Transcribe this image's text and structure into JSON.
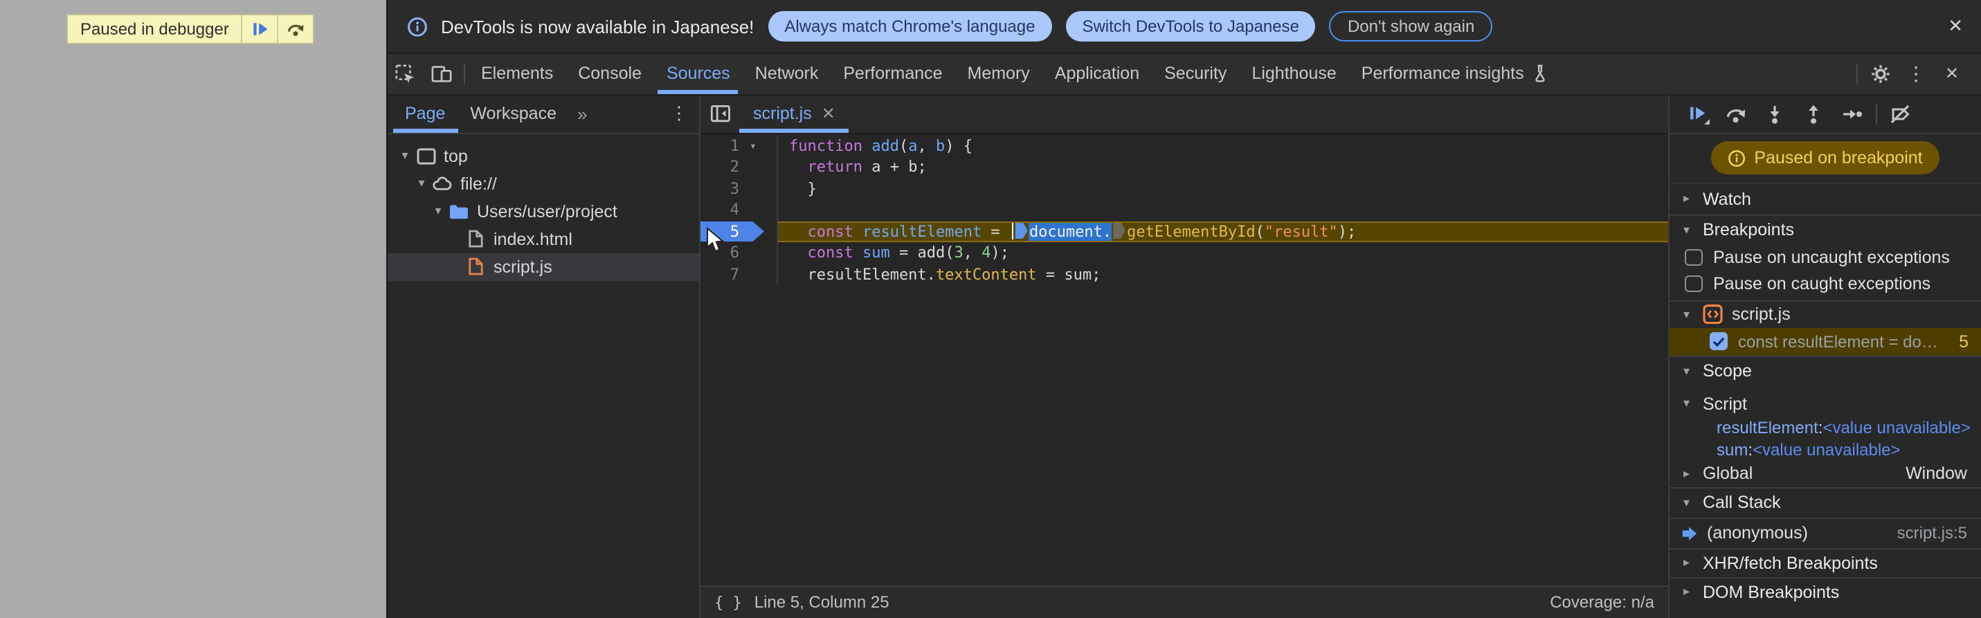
{
  "page": {
    "paused_banner_label": "Paused in debugger"
  },
  "infobar": {
    "message": "DevTools is now available in Japanese!",
    "buttons": [
      "Always match Chrome's language",
      "Switch DevTools to Japanese",
      "Don't show again"
    ],
    "close": "✕"
  },
  "tabbar": {
    "tabs": [
      "Elements",
      "Console",
      "Sources",
      "Network",
      "Performance",
      "Memory",
      "Application",
      "Security",
      "Lighthouse",
      "Performance insights"
    ],
    "active": "Sources",
    "menu": "⋮",
    "close": "✕"
  },
  "navigator": {
    "tabs": {
      "page": "Page",
      "workspace": "Workspace",
      "more": "»",
      "menu": "⋮"
    },
    "tree": {
      "top": "top",
      "file_scheme": "file://",
      "folder": "Users/user/project",
      "file1": "index.html",
      "file2": "script.js"
    }
  },
  "editor": {
    "tab_label": "script.js",
    "tab_close": "✕",
    "code": {
      "lines": [
        {
          "num": 1,
          "fold": true,
          "tokens": [
            {
              "t": "function",
              "c": "kw"
            },
            {
              "t": " "
            },
            {
              "t": "add",
              "c": "def"
            },
            {
              "t": "("
            },
            {
              "t": "a",
              "c": "def"
            },
            {
              "t": ", "
            },
            {
              "t": "b",
              "c": "def"
            },
            {
              "t": ") {"
            }
          ]
        },
        {
          "num": 2,
          "tokens": [
            {
              "t": "  "
            },
            {
              "t": "return",
              "c": "kw"
            },
            {
              "t": " a + b;"
            }
          ]
        },
        {
          "num": 3,
          "tokens": [
            {
              "t": "  }"
            }
          ]
        },
        {
          "num": 4,
          "tokens": []
        },
        {
          "num": 5,
          "current": true,
          "breakpoint": true,
          "tokens": [
            {
              "t": "  "
            },
            {
              "t": "const",
              "c": "kw"
            },
            {
              "t": " "
            },
            {
              "t": "resultElement",
              "c": "def"
            },
            {
              "t": " = "
            },
            {
              "m": "caret"
            },
            {
              "m": "blue"
            },
            {
              "t": "document.",
              "c": "sel"
            },
            {
              "m": "grey"
            },
            {
              "t": "getElementById",
              "c": "prop"
            },
            {
              "t": "("
            },
            {
              "t": "\"result\"",
              "c": "str"
            },
            {
              "t": ");"
            }
          ]
        },
        {
          "num": 6,
          "tokens": [
            {
              "t": "  "
            },
            {
              "t": "const",
              "c": "kw"
            },
            {
              "t": " "
            },
            {
              "t": "sum",
              "c": "def"
            },
            {
              "t": " = add("
            },
            {
              "t": "3",
              "c": "num"
            },
            {
              "t": ", "
            },
            {
              "t": "4",
              "c": "num"
            },
            {
              "t": ");"
            }
          ]
        },
        {
          "num": 7,
          "tokens": [
            {
              "t": "  resultElement."
            },
            {
              "t": "textContent",
              "c": "prop"
            },
            {
              "t": " = sum;"
            }
          ]
        }
      ]
    },
    "status": {
      "line_col": "Line 5, Column 25",
      "braces": "{ }",
      "coverage": "Coverage: n/a"
    }
  },
  "debugger": {
    "paused_badge": "Paused on breakpoint",
    "watch": "Watch",
    "breakpoints": "Breakpoints",
    "pause_uncaught": "Pause on uncaught exceptions",
    "pause_caught": "Pause on caught exceptions",
    "bp_group_file": "script.js",
    "bp_entry_text": "const resultElement = doc…",
    "bp_entry_line": "5",
    "scope": "Scope",
    "scope_script": "Script",
    "vars": [
      {
        "name": "resultElement",
        "sep": ": ",
        "value": "<value unavailable>"
      },
      {
        "name": "sum",
        "sep": ": ",
        "value": "<value unavailable>"
      }
    ],
    "global": "Global",
    "global_value": "Window",
    "call_stack": "Call Stack",
    "frame_name": "(anonymous)",
    "frame_loc": "script.js:5",
    "xhr": "XHR/fetch Breakpoints",
    "dom": "DOM Breakpoints"
  }
}
